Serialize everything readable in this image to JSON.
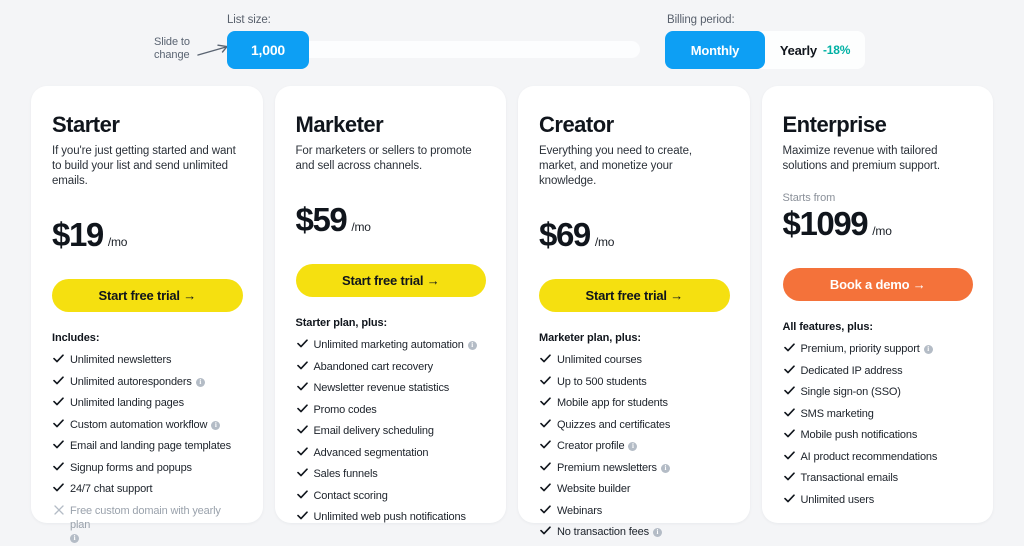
{
  "controls": {
    "slide_hint": "Slide to\nchange",
    "slide_hint_line1": "Slide to",
    "slide_hint_line2": "change",
    "list_size_label": "List size:",
    "list_size_value": "1,000",
    "billing_label": "Billing period:",
    "billing_monthly": "Monthly",
    "billing_yearly": "Yearly",
    "billing_yearly_discount": "-18%",
    "accent_blue": "#0d9ff4",
    "accent_teal": "#00b1a4"
  },
  "plans": [
    {
      "name": "Starter",
      "description": "If you're just getting started and want to build your list and send unlimited emails.",
      "price_prefix": "",
      "price": "$19",
      "period": "/mo",
      "cta": "Start free trial →",
      "cta_style": "yellow",
      "features_heading": "Includes:",
      "features": [
        {
          "label": "Unlimited newsletters",
          "included": true,
          "info": false
        },
        {
          "label": "Unlimited autoresponders",
          "included": true,
          "info": true
        },
        {
          "label": "Unlimited landing pages",
          "included": true,
          "info": false
        },
        {
          "label": "Custom automation workflow",
          "included": true,
          "info": true
        },
        {
          "label": "Email and landing page templates",
          "included": true,
          "info": false
        },
        {
          "label": "Signup forms and popups",
          "included": true,
          "info": false
        },
        {
          "label": "24/7 chat support",
          "included": true,
          "info": false
        },
        {
          "label": "Free custom domain with yearly plan",
          "included": false,
          "info": true
        }
      ]
    },
    {
      "name": "Marketer",
      "description": "For marketers or sellers to promote and sell across channels.",
      "price_prefix": "",
      "price": "$59",
      "period": "/mo",
      "cta": "Start free trial →",
      "cta_style": "yellow",
      "features_heading": "Starter plan, plus:",
      "features": [
        {
          "label": "Unlimited marketing automation",
          "included": true,
          "info": true
        },
        {
          "label": "Abandoned cart recovery",
          "included": true,
          "info": false
        },
        {
          "label": "Newsletter revenue statistics",
          "included": true,
          "info": false
        },
        {
          "label": "Promo codes",
          "included": true,
          "info": false
        },
        {
          "label": "Email delivery scheduling",
          "included": true,
          "info": false
        },
        {
          "label": "Advanced segmentation",
          "included": true,
          "info": false
        },
        {
          "label": "Sales funnels",
          "included": true,
          "info": false
        },
        {
          "label": "Contact scoring",
          "included": true,
          "info": false
        },
        {
          "label": "Unlimited web push notifications",
          "included": true,
          "info": false
        }
      ]
    },
    {
      "name": "Creator",
      "description": "Everything you need to create, market, and monetize your knowledge.",
      "price_prefix": "",
      "price": "$69",
      "period": "/mo",
      "cta": "Start free trial →",
      "cta_style": "yellow",
      "features_heading": "Marketer plan, plus:",
      "features": [
        {
          "label": "Unlimited courses",
          "included": true,
          "info": false
        },
        {
          "label": "Up to 500 students",
          "included": true,
          "info": false
        },
        {
          "label": "Mobile app for students",
          "included": true,
          "info": false
        },
        {
          "label": "Quizzes and certificates",
          "included": true,
          "info": false
        },
        {
          "label": "Creator profile",
          "included": true,
          "info": true
        },
        {
          "label": "Premium newsletters",
          "included": true,
          "info": true
        },
        {
          "label": "Website builder",
          "included": true,
          "info": false
        },
        {
          "label": "Webinars",
          "included": true,
          "info": false
        },
        {
          "label": "No transaction fees",
          "included": true,
          "info": true
        }
      ]
    },
    {
      "name": "Enterprise",
      "description": "Maximize revenue with tailored solutions and premium support.",
      "price_prefix": "Starts from",
      "price": "$1099",
      "period": "/mo",
      "cta": "Book a demo →",
      "cta_style": "orange",
      "features_heading": "All features, plus:",
      "features": [
        {
          "label": "Premium, priority support",
          "included": true,
          "info": true
        },
        {
          "label": "Dedicated IP address",
          "included": true,
          "info": false
        },
        {
          "label": "Single sign-on (SSO)",
          "included": true,
          "info": false
        },
        {
          "label": "SMS marketing",
          "included": true,
          "info": false
        },
        {
          "label": "Mobile push notifications",
          "included": true,
          "info": false
        },
        {
          "label": "AI product recommendations",
          "included": true,
          "info": false
        },
        {
          "label": "Transactional emails",
          "included": true,
          "info": false
        },
        {
          "label": "Unlimited users",
          "included": true,
          "info": false
        }
      ]
    }
  ]
}
